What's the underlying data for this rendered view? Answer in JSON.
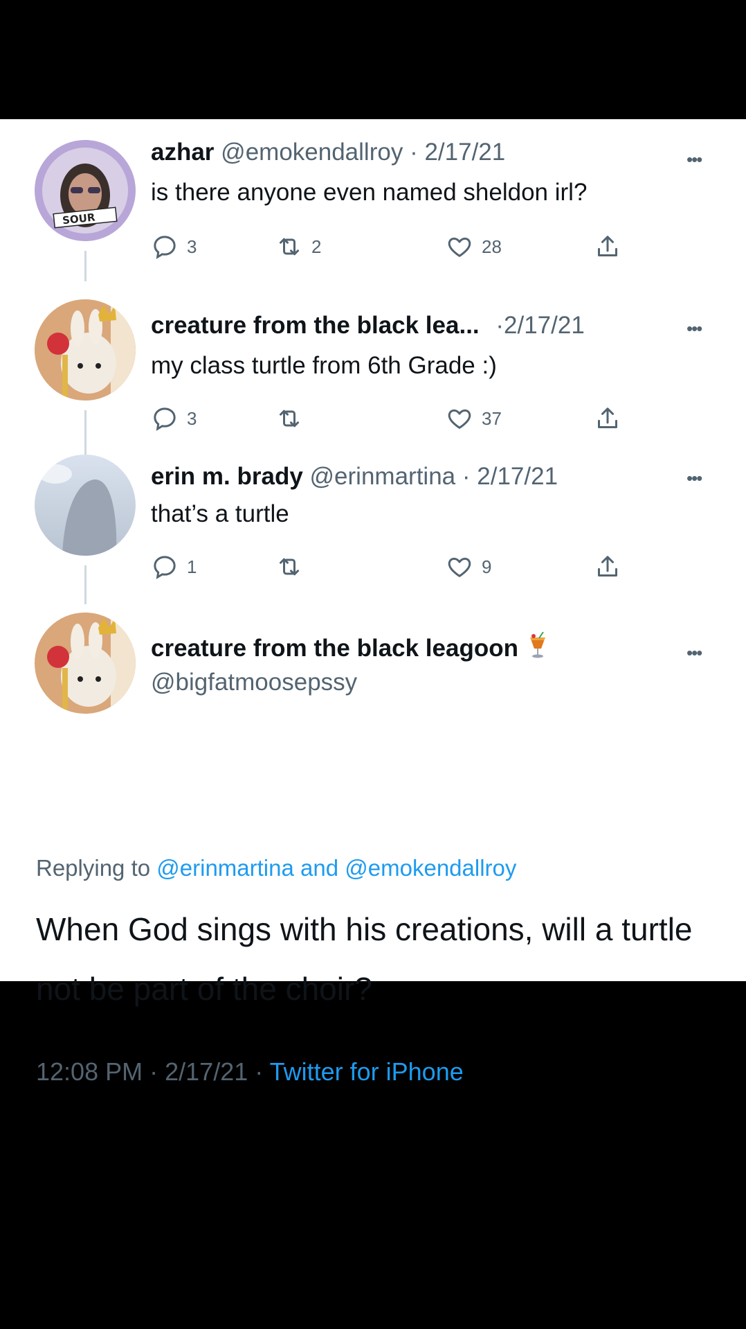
{
  "tweets": [
    {
      "name": "azhar",
      "handle": "@emokendallroy",
      "date": "2/17/21",
      "text": "is there anyone even named sheldon irl?",
      "avatar_badge": "SOUR",
      "counts": {
        "reply": "3",
        "retweet": "2",
        "like": "28"
      }
    },
    {
      "name": "creature from the black lea...",
      "handle": "",
      "date": "2/17/21",
      "text": "my class turtle from 6th Grade :)",
      "counts": {
        "reply": "3",
        "retweet": "",
        "like": "37"
      }
    },
    {
      "name": "erin m. brady",
      "handle": "@erinmartina",
      "date": "2/17/21",
      "text": "that’s a turtle",
      "counts": {
        "reply": "1",
        "retweet": "",
        "like": "9"
      }
    }
  ],
  "main_tweet": {
    "name": "creature from the black leagoon",
    "name_emoji": "tropical-drink-icon",
    "handle": "@bigfatmoosepssy",
    "replying_prefix": "Replying to",
    "replying_user1": "@erinmartina",
    "replying_and": "and",
    "replying_user2": "@emokendallroy",
    "text": "When God sings with his creations, will a turtle not be part of the choir?",
    "time": "12:08 PM",
    "date": "2/17/21",
    "source": "Twitter for iPhone"
  },
  "separator": "·",
  "more_label": "•••",
  "colors": {
    "link": "#1d9bf0",
    "muted": "#536471",
    "text": "#0f1419",
    "thread_line": "#cfd9de"
  }
}
